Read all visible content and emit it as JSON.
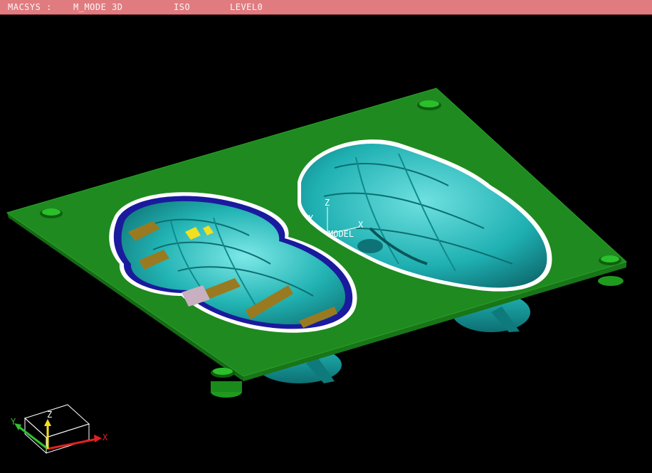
{
  "titlebar": {
    "app": "MACSYS :",
    "mode": "M_MODE 3D",
    "view": "ISO",
    "level": "LEVEL0"
  },
  "model_axis": {
    "x": "X",
    "y": "Y",
    "z": "Z",
    "name": "MODEL"
  },
  "view_triad": {
    "x": "X",
    "y": "Y",
    "z": "Z"
  },
  "colors": {
    "titlebar": "#e07c80",
    "background": "#000000",
    "plate": "#1f8a1f",
    "cavity": "#22b3b3",
    "cavity_rim": "#1a1a9e",
    "gate_insert": "#9a7a20",
    "triad_x": "#e02020",
    "triad_y": "#30c030",
    "triad_z": "#f0e020"
  }
}
